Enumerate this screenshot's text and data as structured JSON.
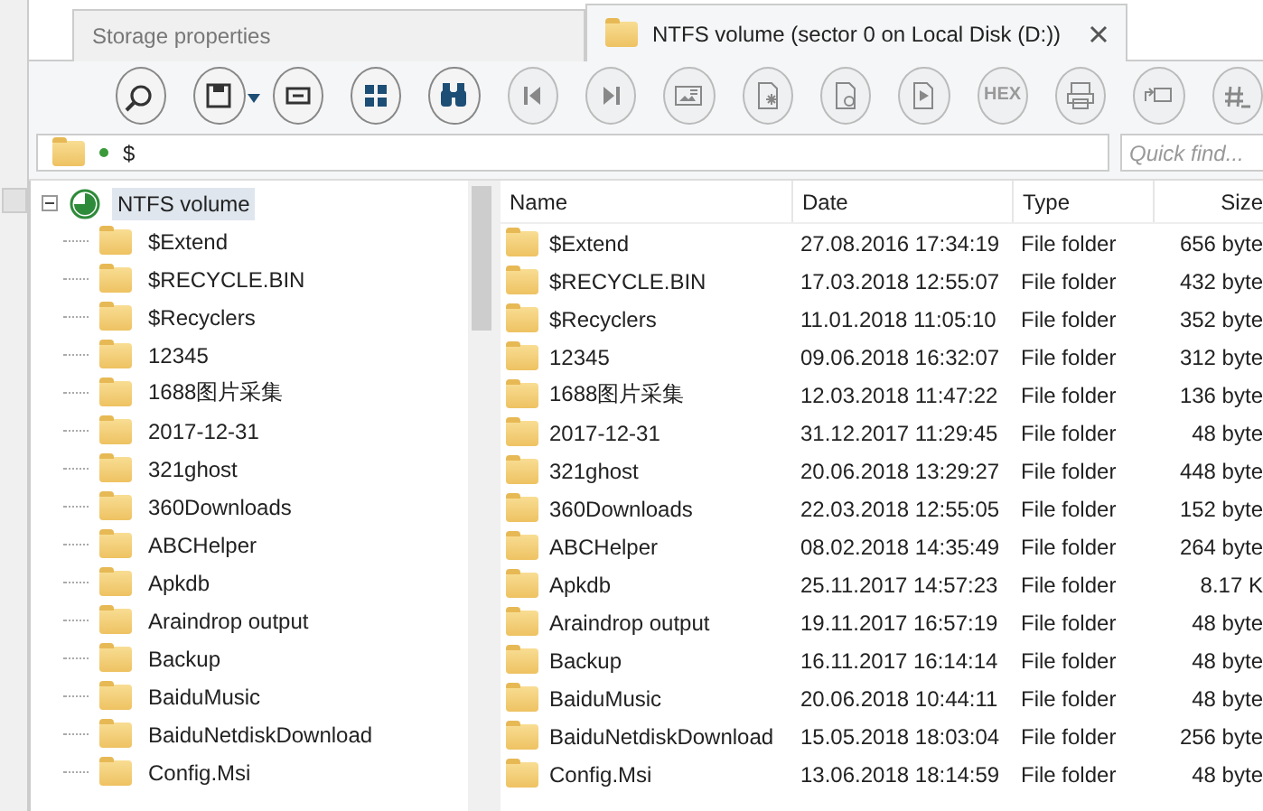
{
  "tabs": [
    {
      "label": "Storage properties",
      "selected": false,
      "closable": false
    },
    {
      "label": "NTFS volume (sector 0 on Local Disk (D:))",
      "selected": true,
      "closable": true
    }
  ],
  "toolbar": [
    {
      "kind": "icon",
      "disabled": false
    },
    {
      "kind": "icon",
      "disabled": false,
      "dropdown": true
    },
    {
      "kind": "icon",
      "disabled": false
    },
    {
      "kind": "icon",
      "disabled": false
    },
    {
      "kind": "icon",
      "disabled": false
    },
    {
      "kind": "icon",
      "disabled": true
    },
    {
      "kind": "icon",
      "disabled": true
    },
    {
      "kind": "icon",
      "disabled": true
    },
    {
      "kind": "icon",
      "disabled": true
    },
    {
      "kind": "icon",
      "disabled": true
    },
    {
      "kind": "icon",
      "disabled": true
    },
    {
      "kind": "text",
      "label": "HEX",
      "disabled": true
    },
    {
      "kind": "icon",
      "disabled": true
    },
    {
      "kind": "icon",
      "disabled": true
    },
    {
      "kind": "icon",
      "disabled": true
    }
  ],
  "address": {
    "path": "$"
  },
  "quick_find": {
    "placeholder": "Quick find..."
  },
  "tree": {
    "label": "NTFS volume",
    "selected": true,
    "expanded": true,
    "children": [
      {
        "label": "$Extend",
        "selected": false
      },
      {
        "label": "$RECYCLE.BIN",
        "selected": false
      },
      {
        "label": "$Recyclers",
        "selected": false
      },
      {
        "label": "12345",
        "selected": false
      },
      {
        "label": "1688图片采集",
        "selected": false
      },
      {
        "label": "2017-12-31",
        "selected": false
      },
      {
        "label": "321ghost",
        "selected": false
      },
      {
        "label": "360Downloads",
        "selected": false
      },
      {
        "label": "ABCHelper",
        "selected": false
      },
      {
        "label": "Apkdb",
        "selected": false
      },
      {
        "label": "Araindrop output",
        "selected": false
      },
      {
        "label": "Backup",
        "selected": false
      },
      {
        "label": "BaiduMusic",
        "selected": false
      },
      {
        "label": "BaiduNetdiskDownload",
        "selected": false
      },
      {
        "label": "Config.Msi",
        "selected": false
      }
    ]
  },
  "table": {
    "columns": [
      "Name",
      "Date",
      "Type",
      "Size"
    ],
    "rows": [
      [
        "$Extend",
        "27.08.2016 17:34:19",
        "File folder",
        "656 byte"
      ],
      [
        "$RECYCLE.BIN",
        "17.03.2018 12:55:07",
        "File folder",
        "432 byte"
      ],
      [
        "$Recyclers",
        "11.01.2018 11:05:10",
        "File folder",
        "352 byte"
      ],
      [
        "12345",
        "09.06.2018 16:32:07",
        "File folder",
        "312 byte"
      ],
      [
        "1688图片采集",
        "12.03.2018 11:47:22",
        "File folder",
        "136 byte"
      ],
      [
        "2017-12-31",
        "31.12.2017 11:29:45",
        "File folder",
        "48 byte"
      ],
      [
        "321ghost",
        "20.06.2018 13:29:27",
        "File folder",
        "448 byte"
      ],
      [
        "360Downloads",
        "22.03.2018 12:55:05",
        "File folder",
        "152 byte"
      ],
      [
        "ABCHelper",
        "08.02.2018 14:35:49",
        "File folder",
        "264 byte"
      ],
      [
        "Apkdb",
        "25.11.2017 14:57:23",
        "File folder",
        "8.17 K"
      ],
      [
        "Araindrop output",
        "19.11.2017 16:57:19",
        "File folder",
        "48 byte"
      ],
      [
        "Backup",
        "16.11.2017 16:14:14",
        "File folder",
        "48 byte"
      ],
      [
        "BaiduMusic",
        "20.06.2018 10:44:11",
        "File folder",
        "48 byte"
      ],
      [
        "BaiduNetdiskDownload",
        "15.05.2018 18:03:04",
        "File folder",
        "256 byte"
      ],
      [
        "Config.Msi",
        "13.06.2018 18:14:59",
        "File folder",
        "48 byte"
      ]
    ]
  }
}
